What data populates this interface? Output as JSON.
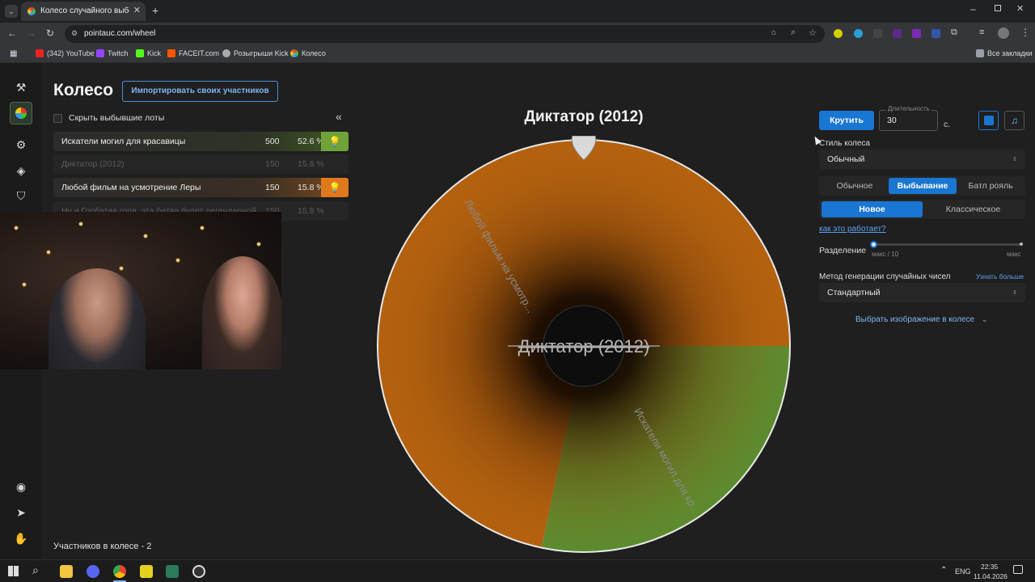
{
  "browser": {
    "tab_title": "Колесо случайного выбора – ",
    "url": "pointauc.com/wheel",
    "bookmarks": [
      "(342) YouTube",
      "Twitch",
      "Kick",
      "FACEIT.com",
      "Розыгрыши Kick",
      "Колесо"
    ],
    "all_bookmarks": "Все закладки"
  },
  "page": {
    "title": "Колесо",
    "import_button": "Импортировать своих участников",
    "hide_lots_label": "Скрыть выбывшие лоты",
    "collapse_icon": "«",
    "lots": [
      {
        "name": "Искатели могил для красавицы",
        "amount": "500",
        "percent": "52.6 %",
        "color": "#6fa33a",
        "eliminated": false
      },
      {
        "name": "Диктатор (2012)",
        "amount": "150",
        "percent": "15.8 %",
        "color": "",
        "eliminated": true
      },
      {
        "name": "Любой фильм на усмотрение Леры",
        "amount": "150",
        "percent": "15.8 %",
        "color": "#e0791e",
        "eliminated": false
      },
      {
        "name": "Ну и Горбатая гора, эта битва будет легендарной",
        "amount": "150",
        "percent": "15.8 %",
        "color": "",
        "eliminated": true
      }
    ],
    "participants_count": "Участников в колесе - 2"
  },
  "wheel": {
    "winner_title": "Диктатор (2012)",
    "center_text": "Диктатор (2012)",
    "segment_orange_label": "Любой фильм на усмотр...",
    "segment_green_label": "Искатели могил для кр..."
  },
  "settings": {
    "spin_button": "Крутить",
    "duration_label": "Длительность",
    "duration_value": "30",
    "duration_unit": "с.",
    "wheel_style_label": "Стиль колеса",
    "wheel_style_value": "Обычный",
    "modes": [
      "Обычное",
      "Выбывание",
      "Батл рояль"
    ],
    "active_mode": "Выбывание",
    "variants": [
      "Новое",
      "Классическое"
    ],
    "active_variant": "Новое",
    "how_it_works": "как это работает?",
    "split_label": "Разделение",
    "split_min": "макс / 10",
    "split_max": "макс",
    "rng_label": "Метод генерации случайных чисел",
    "rng_more": "Узнать больше",
    "rng_value": "Стандартный",
    "choose_image": "Выбрать изображение в колесе"
  },
  "taskbar": {
    "lang": "ENG",
    "time": "22:35",
    "date": "11.04.2026"
  },
  "colors": {
    "accent_blue": "#1976d2",
    "wheel_orange": "#b3610f",
    "wheel_green": "#5b8b2e"
  }
}
